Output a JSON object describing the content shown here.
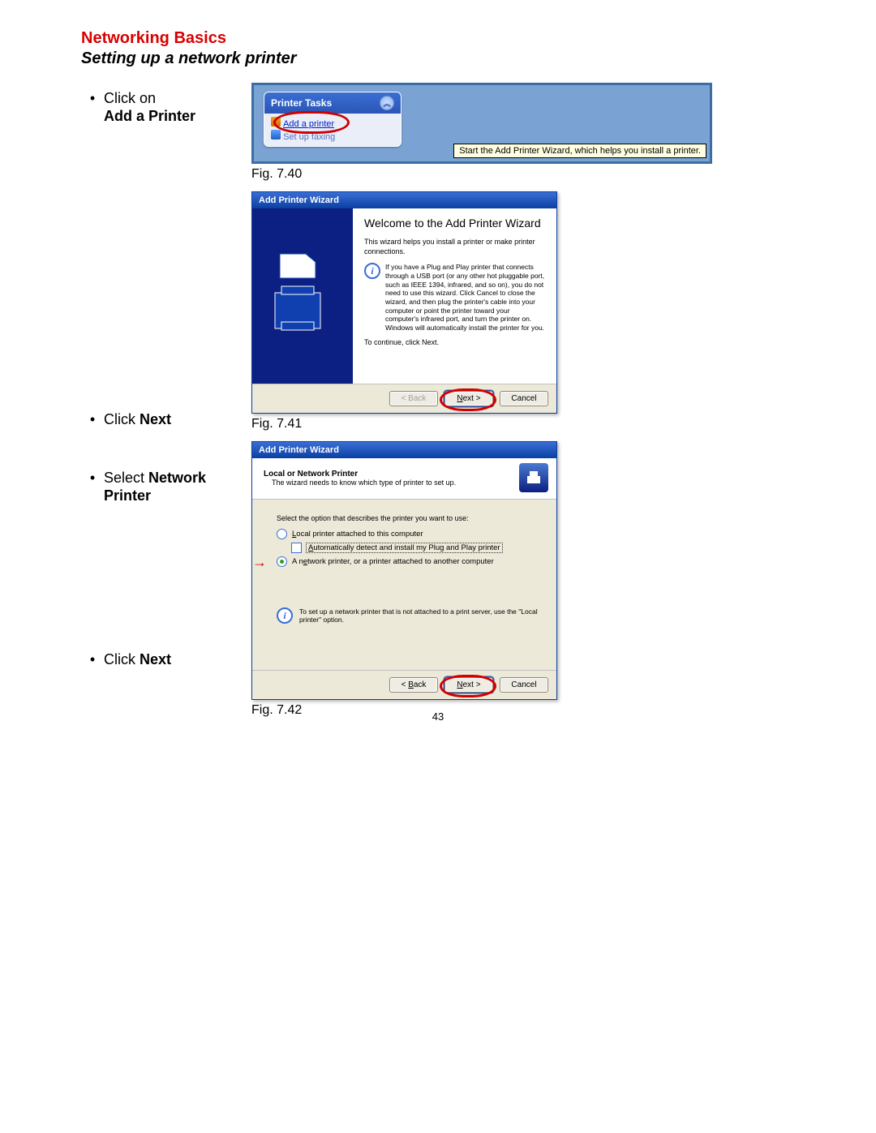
{
  "headings": {
    "title": "Networking Basics",
    "subtitle": "Setting up a network printer"
  },
  "bullets": {
    "b1a": "Click on",
    "b1b": "Add a Printer",
    "b2a": "Click ",
    "b2b": "Next",
    "b3a": "Select ",
    "b3b": "Network Printer",
    "b4a": "Click ",
    "b4b": "Next"
  },
  "captions": {
    "c1": "Fig. 7.40",
    "c2": "Fig. 7.41",
    "c3": "Fig. 7.42"
  },
  "page_number": "43",
  "fig40": {
    "panel_title": "Printer Tasks",
    "link_add": "Add a printer",
    "link_fax": "Set up faxing",
    "tooltip": "Start the Add Printer Wizard, which helps you install a printer.",
    "collapse_glyph": "︽"
  },
  "fig41": {
    "titlebar": "Add Printer Wizard",
    "heading": "Welcome to the Add Printer Wizard",
    "p1": "This wizard helps you install a printer or make printer connections.",
    "info": "If you have a Plug and Play printer that connects through a USB port (or any other hot pluggable port, such as IEEE 1394, infrared, and so on), you do not need to use this wizard. Click Cancel to close the wizard, and then plug the printer's cable into your computer or point the printer toward your computer's infrared port, and turn the printer on. Windows will automatically install the printer for you.",
    "p2": "To continue, click Next.",
    "back": "< Back",
    "next_u": "N",
    "next_rest": "ext >",
    "cancel": "Cancel"
  },
  "fig42": {
    "titlebar": "Add Printer Wizard",
    "head_t": "Local or Network Printer",
    "head_s": "The wizard needs to know which type of printer to set up.",
    "q": "Select the option that describes the printer you want to use:",
    "opt1_u": "L",
    "opt1": "ocal printer attached to this computer",
    "opt1a_u": "A",
    "opt1a": "utomatically detect and install my Plug and Play printer",
    "opt2": "A n",
    "opt2_u": "e",
    "opt2_rest": "twork printer, or a printer attached to another computer",
    "info": "To set up a network printer that is not attached to a print server, use the \"Local printer\" option.",
    "back_u": "B",
    "back_rest": "ack",
    "back_pre": "< ",
    "next_u": "N",
    "next_rest": "ext >",
    "cancel": "Cancel",
    "arrow": "→"
  }
}
